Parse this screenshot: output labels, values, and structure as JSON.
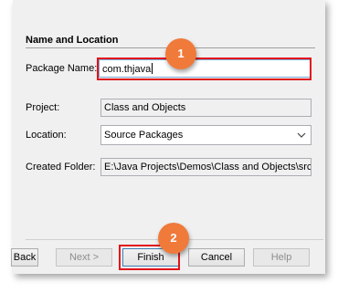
{
  "form": {
    "section_title": "Name and Location",
    "package_name": {
      "label": "Package Name:",
      "value": "com.thjava"
    },
    "project": {
      "label": "Project:",
      "value": "Class and Objects"
    },
    "location": {
      "label": "Location:",
      "value": "Source Packages"
    },
    "created_folder": {
      "label": "Created Folder:",
      "value": "E:\\Java Projects\\Demos\\Class and Objects\\src\\"
    }
  },
  "buttons": {
    "back": "Back",
    "next": "Next >",
    "finish": "Finish",
    "cancel": "Cancel",
    "help": "Help"
  },
  "annotations": {
    "step1": "1",
    "step2": "2"
  },
  "colors": {
    "highlight": "#e2141b",
    "badge": "#f07a3a",
    "dialog_bg": "#f0f0f0"
  }
}
